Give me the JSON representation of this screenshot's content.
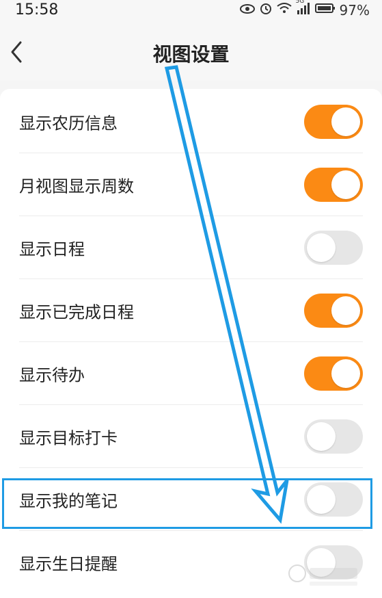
{
  "status_bar": {
    "time": "15:58",
    "icons": [
      "eye-icon",
      "alarm-icon",
      "wifi-icon",
      "signal-icon",
      "battery-icon"
    ],
    "network": "5G",
    "battery_percent": "97%"
  },
  "header": {
    "title": "视图设置"
  },
  "settings": [
    {
      "label": "显示农历信息",
      "on": true
    },
    {
      "label": "月视图显示周数",
      "on": true
    },
    {
      "label": "显示日程",
      "on": false
    },
    {
      "label": "显示已完成日程",
      "on": true
    },
    {
      "label": "显示待办",
      "on": true
    },
    {
      "label": "显示目标打卡",
      "on": false
    },
    {
      "label": "显示我的笔记",
      "on": false
    },
    {
      "label": "显示生日提醒",
      "on": false
    }
  ],
  "colors": {
    "switch_on": "#fb8a14",
    "switch_off": "#e6e6e6",
    "annotation": "#1e9be4"
  }
}
